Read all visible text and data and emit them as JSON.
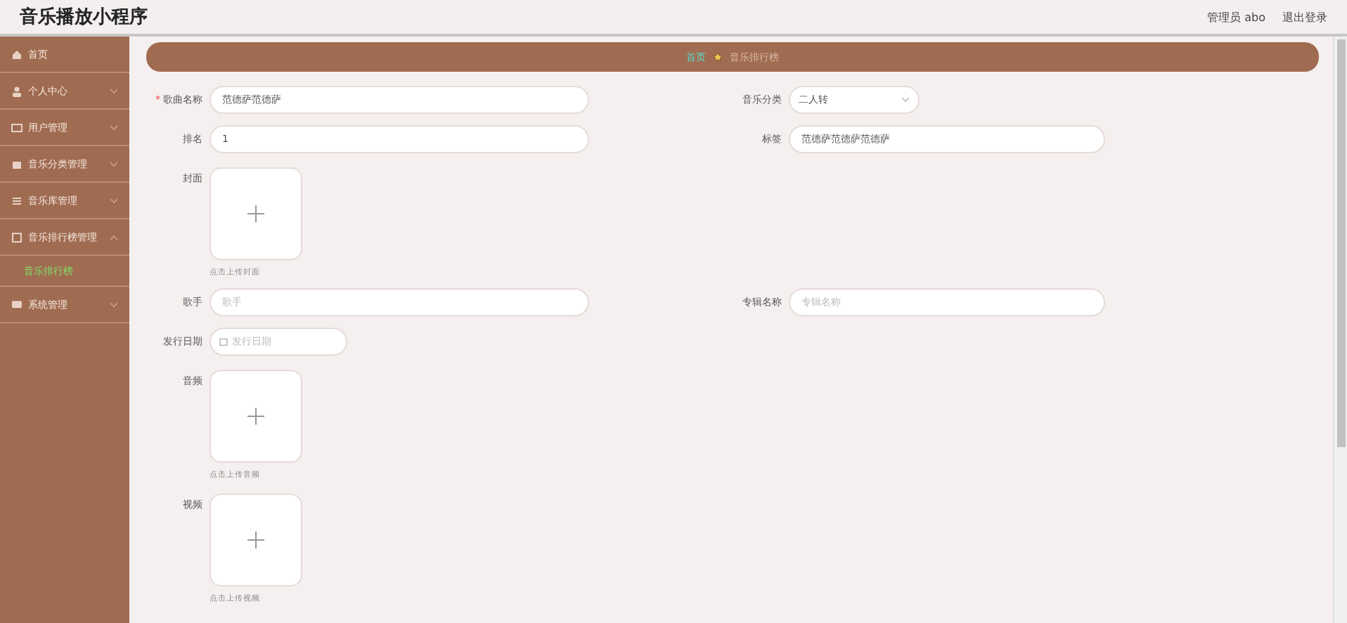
{
  "header": {
    "title": "音乐播放小程序",
    "user": "管理员 abo",
    "logout": "退出登录"
  },
  "sidebar": {
    "items": [
      {
        "kind": "link",
        "label": "首页"
      },
      {
        "kind": "group",
        "label": "个人中心",
        "expanded": false
      },
      {
        "kind": "group",
        "label": "用户管理",
        "expanded": false
      },
      {
        "kind": "group",
        "label": "音乐分类管理",
        "expanded": false
      },
      {
        "kind": "group",
        "label": "音乐库管理",
        "expanded": false
      },
      {
        "kind": "group",
        "label": "音乐排行榜管理",
        "expanded": true,
        "children": [
          {
            "label": "音乐排行榜",
            "selected": true
          }
        ]
      },
      {
        "kind": "group",
        "label": "系统管理",
        "expanded": false
      }
    ]
  },
  "breadcrumb": {
    "home": "首页",
    "current": "音乐排行榜"
  },
  "form": {
    "rows": [
      {
        "left": {
          "kind": "text",
          "label": "歌曲名称",
          "required_mark": "*",
          "value": "范德萨范德萨"
        },
        "right": {
          "kind": "select",
          "label": "音乐分类",
          "value": "二人转"
        }
      },
      {
        "left": {
          "kind": "text",
          "label": "排名",
          "value": "1"
        },
        "right": {
          "kind": "text",
          "label": "标签",
          "value": "范德萨范德萨范德萨"
        }
      },
      {
        "left": {
          "kind": "upload",
          "label": "封面",
          "hint": "点击上传封面"
        }
      },
      {
        "left": {
          "kind": "text",
          "label": "歌手",
          "placeholder": "歌手"
        },
        "right": {
          "kind": "text",
          "label": "专辑名称",
          "placeholder": "专辑名称"
        }
      },
      {
        "left": {
          "kind": "date",
          "label": "发行日期",
          "placeholder": "发行日期"
        }
      },
      {
        "left": {
          "kind": "upload",
          "label": "音频",
          "hint": "点击上传音频"
        }
      },
      {
        "left": {
          "kind": "upload",
          "label": "视频",
          "hint": "点击上传视频"
        }
      }
    ]
  }
}
